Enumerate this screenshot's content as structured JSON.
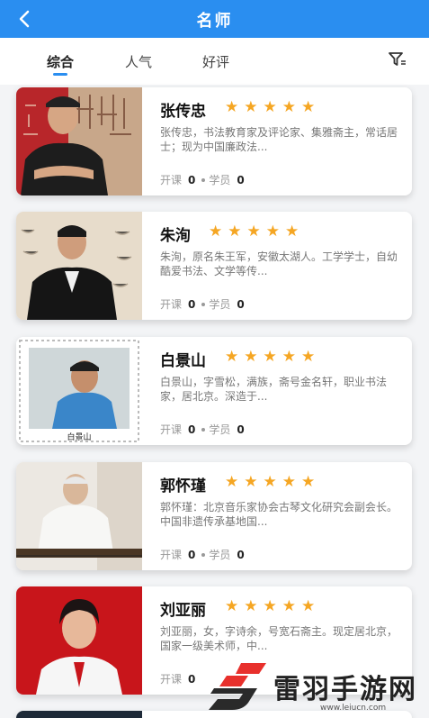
{
  "header": {
    "title": "名师"
  },
  "tabs": [
    {
      "label": "综合"
    },
    {
      "label": "人气"
    },
    {
      "label": "好评"
    }
  ],
  "stats_labels": {
    "courses": "开课",
    "students": "学员"
  },
  "teachers": [
    {
      "name": "张传忠",
      "rating": 5,
      "desc": "张传忠，书法教育家及评论家、集雅斋主，常话居士；现为中国廉政法...",
      "courses": "0",
      "students": "0"
    },
    {
      "name": "朱洵",
      "rating": 5,
      "desc": "朱洵，原名朱王军，安徽太湖人。工学学士，自幼酷爱书法、文学等传...",
      "courses": "0",
      "students": "0"
    },
    {
      "name": "白景山",
      "rating": 5,
      "desc": "白景山，字雪松，满族，斋号金名轩，职业书法家，居北京。深造于...",
      "courses": "0",
      "students": "0",
      "photo_caption": "白景山"
    },
    {
      "name": "郭怀瑾",
      "rating": 5,
      "desc": "郭怀瑾：北京音乐家协会古琴文化研究会副会长。中国非遗传承基地国...",
      "courses": "0",
      "students": "0"
    },
    {
      "name": "刘亚丽",
      "rating": 5,
      "desc": "刘亚丽，女，字诗余，号宽石斋主。现定居北京，国家一级美术师，中...",
      "courses": "0",
      "students": ""
    }
  ],
  "watermark": {
    "text": "雷羽手游网",
    "url": "www.leiucn.com"
  },
  "colors": {
    "accent": "#2a8ef0",
    "star": "#f5a623"
  }
}
